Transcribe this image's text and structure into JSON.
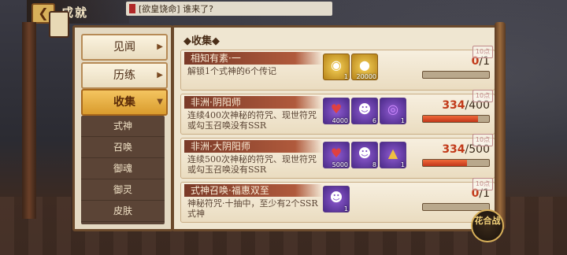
{
  "header": {
    "back_label": "❮",
    "title": "成就",
    "chat_message": "[欲皇饶命] 谁来了?"
  },
  "left_nav": {
    "tabs": [
      {
        "label": "见闻",
        "active": false
      },
      {
        "label": "历练",
        "active": false
      },
      {
        "label": "收集",
        "active": true
      }
    ],
    "sub_items": [
      "式神",
      "召唤",
      "御魂",
      "御灵",
      "皮肤"
    ]
  },
  "main": {
    "section_title": "◆收集◆",
    "rows": [
      {
        "title": "相知有素·一",
        "desc": "解锁1个式神的6个传记",
        "rewards": [
          {
            "icon": "gold-ingot-icon",
            "count": "1"
          },
          {
            "icon": "gold-coin-icon",
            "count": "20000"
          }
        ],
        "progress_current": "0",
        "progress_total": "/1",
        "progress_fraction": 0.0,
        "stamp": "10点"
      },
      {
        "title": "非洲·阴阳师",
        "desc": "连续400次神秘的符咒、现世符咒或勾玉召唤没有SSR",
        "rewards": [
          {
            "icon": "red-charm-icon",
            "count": "4000"
          },
          {
            "icon": "daruma-icon",
            "count": "6"
          },
          {
            "icon": "purple-orb-icon",
            "count": "1"
          }
        ],
        "progress_current": "334",
        "progress_total": "/400",
        "progress_fraction": 0.835,
        "stamp": "10点"
      },
      {
        "title": "非洲·大阴阳师",
        "desc": "连续500次神秘的符咒、现世符咒或勾玉召唤没有SSR",
        "rewards": [
          {
            "icon": "red-charm-icon",
            "count": "5000"
          },
          {
            "icon": "daruma-icon",
            "count": "8"
          },
          {
            "icon": "wizard-hat-icon",
            "count": "1"
          }
        ],
        "progress_current": "334",
        "progress_total": "/500",
        "progress_fraction": 0.668,
        "stamp": "10点"
      },
      {
        "title": "式神召唤·福惠双至",
        "desc": "神秘符咒·十抽中，至少有2个SSR式神",
        "rewards": [
          {
            "icon": "material-daruma-icon",
            "count": "1"
          }
        ],
        "progress_current": "0",
        "progress_total": "/1",
        "progress_fraction": 0.0,
        "stamp": "10点"
      }
    ]
  },
  "battle_button": "花合战",
  "colors": {
    "accent": "#d99b2d",
    "progress": "#c2361a",
    "panel": "#efe6d1"
  }
}
